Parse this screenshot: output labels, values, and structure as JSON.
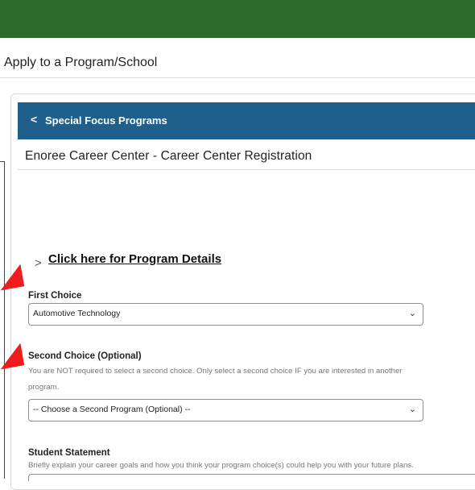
{
  "page": {
    "title": "Apply to a Program/School"
  },
  "header": {
    "back_label": "Special Focus Programs"
  },
  "card": {
    "title": "Enoree Career Center - Career Center Registration"
  },
  "details_link": "Click here for Program Details",
  "first_choice": {
    "label": "First Choice",
    "value": "Automotive Technology"
  },
  "second_choice": {
    "label": "Second Choice (Optional)",
    "help": "You are NOT required to select a second choice. Only select a second choice IF you are interested in another program.",
    "value": "-- Choose a Second Program (Optional) --"
  },
  "statement": {
    "label": "Student Statement",
    "help": "Briefly explain your career goals and how you think your program choice(s) could help you with your future plans."
  },
  "colors": {
    "topbar": "#2a6a2d",
    "header": "#1f5f8b",
    "annotation_arrow": "#ee1c1c"
  },
  "icons": {
    "back": "chevron-left-icon",
    "expand": "chevron-right-icon",
    "dropdown": "chevron-down-icon"
  }
}
